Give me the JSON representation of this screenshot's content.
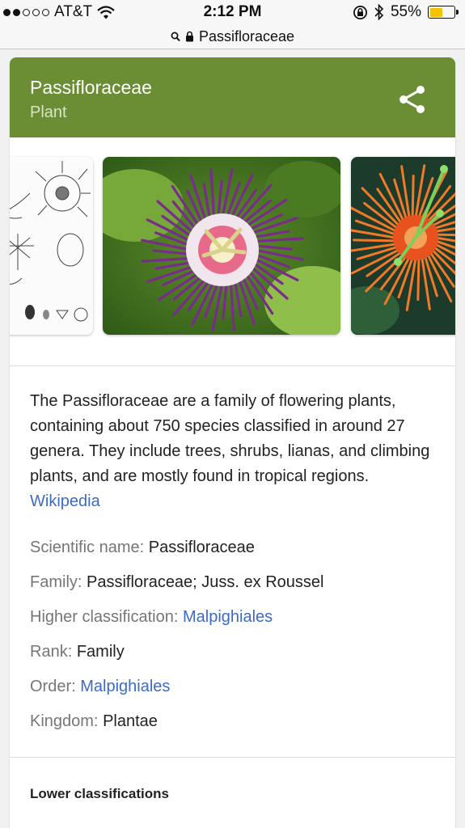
{
  "status_bar": {
    "carrier": "AT&T",
    "time": "2:12 PM",
    "battery": "55%",
    "battery_level": 0.55
  },
  "url_bar": {
    "query": "Passifloraceae"
  },
  "card": {
    "title": "Passifloraceae",
    "subtitle": "Plant",
    "accent_color": "#6b8e35",
    "description": "The Passifloraceae are a family of flowering plants, containing about 750 species classified in around 27 genera. They include trees, shrubs, lianas, and climbing plants, and are mostly found in tropical regions.",
    "source_link": "Wikipedia",
    "facts": [
      {
        "key": "Scientific name: ",
        "value": "Passifloraceae",
        "is_link": false
      },
      {
        "key": "Family: ",
        "value": "Passifloraceae; Juss. ex Roussel",
        "is_link": false
      },
      {
        "key": "Higher classification: ",
        "value": "Malpighiales",
        "is_link": true
      },
      {
        "key": "Rank: ",
        "value": "Family",
        "is_link": false
      },
      {
        "key": "Order: ",
        "value": "Malpighiales",
        "is_link": true
      },
      {
        "key": "Kingdom: ",
        "value": "Plantae",
        "is_link": false
      }
    ],
    "lower_heading": "Lower classifications"
  }
}
